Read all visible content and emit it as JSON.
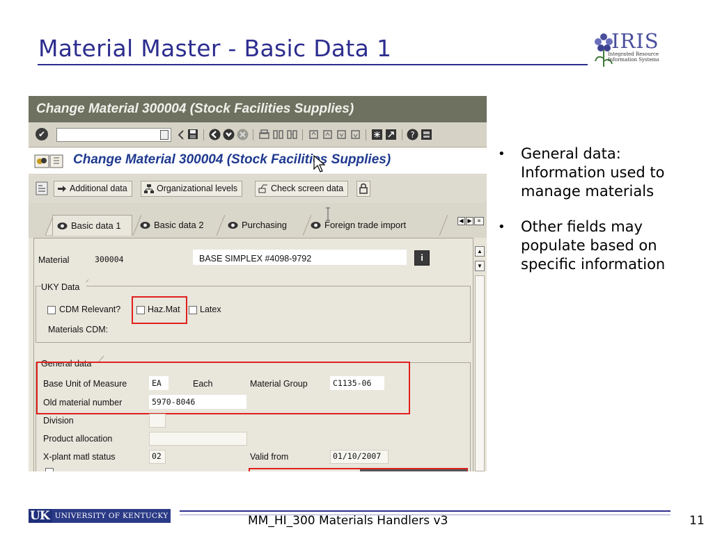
{
  "slide": {
    "title": "Material Master - Basic Data 1",
    "logo_big": "IRIS",
    "logo_line1": "Integrated Resource",
    "logo_line2": "Information Systems",
    "bullets": [
      "General data: Information used to manage materials",
      "Other fields may populate based on specific information"
    ],
    "footer_uk": "UK",
    "footer_university": "UNIVERSITY OF KENTUCKY",
    "footer_text": "MM_HI_300 Materials Handlers v3",
    "page_number": "11"
  },
  "sap": {
    "window_title": "Change Material 300004 (Stock Facilities Supplies)",
    "screen_title": "Change Material 300004 (Stock Facilities Supplies)",
    "app_toolbar": {
      "additional_data": "Additional data",
      "org_levels": "Organizational levels",
      "check_screen": "Check screen data"
    },
    "tabs": [
      "Basic data 1",
      "Basic data 2",
      "Purchasing",
      "Foreign trade import"
    ],
    "material": {
      "label": "Material",
      "value": "300004",
      "description": "BASE SIMPLEX #4098-9792"
    },
    "uky": {
      "title": "UKY Data",
      "cdm_relevant": "CDM Relevant?",
      "haz_mat": "Haz.Mat",
      "latex": "Latex",
      "materials_cdm": "Materials CDM:"
    },
    "general": {
      "title": "General data",
      "base_uom_label": "Base Unit of Measure",
      "base_uom_value": "EA",
      "base_uom_text": "Each",
      "material_group_label": "Material Group",
      "material_group_value": "C1135-06",
      "old_material_label": "Old material number",
      "old_material_value": "5970-8046",
      "division_label": "Division",
      "product_allocation_label": "Product allocation",
      "xplant_status_label": "X-plant matl status",
      "xplant_status_value": "02",
      "valid_from_label": "Valid from",
      "valid_from_value": "01/10/2007"
    }
  },
  "colors": {
    "title_blue": "#2d2d8f",
    "sap_title_bar": "#6f7160",
    "sap_header_text": "#1f3a8f",
    "highlight_red": "#e0201c"
  },
  "icons": [
    "enter-icon",
    "back-icon",
    "save-icon",
    "exit-icon",
    "cancel-icon",
    "print-icon",
    "find-icon",
    "first-page-icon",
    "help-icon",
    "info-icon",
    "lock-icon",
    "scroll-up-icon",
    "scroll-down-icon"
  ]
}
